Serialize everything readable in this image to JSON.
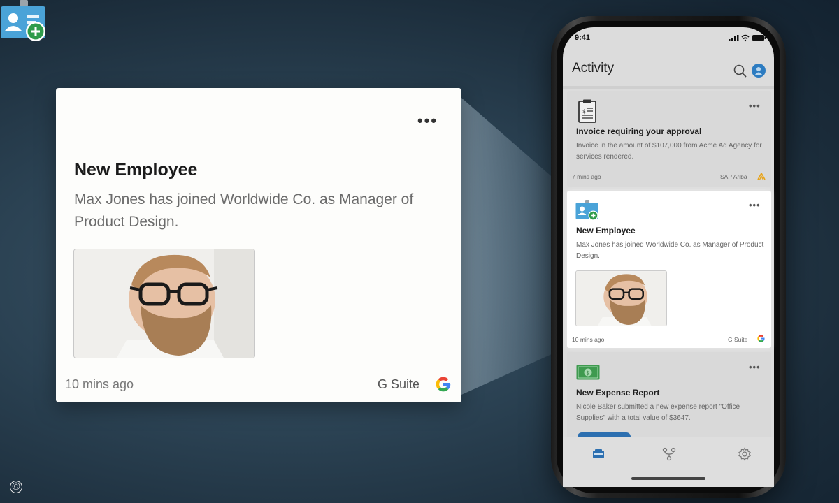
{
  "zoom_card": {
    "title": "New Employee",
    "description": "Max Jones has joined Worldwide Co. as Manager of Product Design.",
    "time": "10 mins ago",
    "source": "G Suite",
    "icon": "new-employee-badge-icon",
    "more_icon": "more-horizontal-icon"
  },
  "phone": {
    "status_time": "9:41",
    "header": {
      "title": "Activity",
      "search_icon": "search-icon",
      "avatar_icon": "user-avatar-icon"
    },
    "cards": [
      {
        "title": "Invoice requiring your approval",
        "description": "Invoice in the amount of $107,000  from Acme Ad Agency for services rendered.",
        "time": "7 mins ago",
        "source": "SAP Ariba",
        "icon": "invoice-clipboard-icon"
      },
      {
        "title": "New Employee",
        "description": "Max Jones has joined Worldwide Co. as Manager of Product Design.",
        "time": "10 mins ago",
        "source": "G Suite",
        "icon": "new-employee-badge-icon"
      },
      {
        "title": "New Expense Report",
        "description": "Nicole Baker submitted a new expense report \"Office Supplies\" with a total value of $3647.",
        "icon": "dollar-bill-icon"
      }
    ],
    "tabs": [
      "activity-tab-icon",
      "workflow-tab-icon",
      "settings-tab-icon"
    ]
  },
  "colors": {
    "accent_blue": "#2c6fb0",
    "add_green": "#2e9b4a",
    "badge_blue": "#4aa3d8",
    "background": "#2b4253"
  },
  "watermark": "©"
}
